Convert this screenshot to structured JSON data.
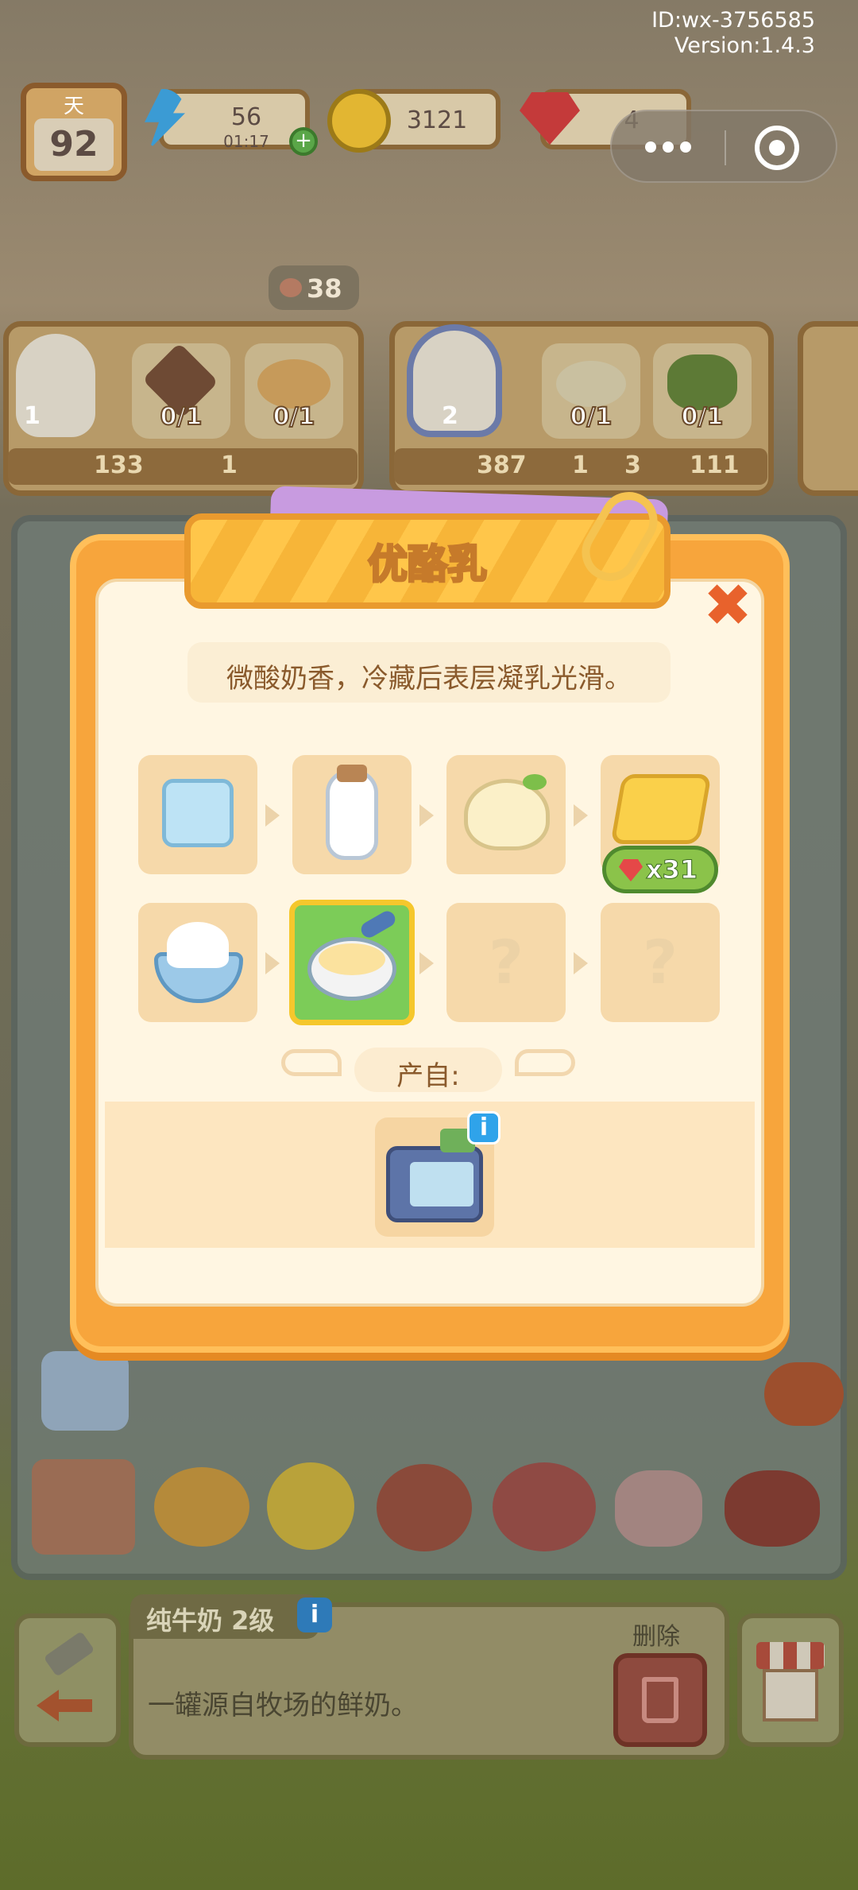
{
  "header": {
    "id_text": "ID:wx-3756585",
    "version_text": "Version:1.4.3",
    "day_label": "天",
    "day_value": "92",
    "energy_value": "56",
    "energy_timer": "01:17",
    "coins_value": "3121",
    "gems_value": "4"
  },
  "orders": {
    "count_badge": "38",
    "cards": [
      {
        "hearts": "1",
        "items": [
          "0/1",
          "0/1"
        ],
        "rewards": [
          "133",
          "1"
        ]
      },
      {
        "hearts": "2",
        "items": [
          "0/1",
          "0/1"
        ],
        "rewards": [
          "387",
          "1",
          "3",
          "111"
        ]
      }
    ]
  },
  "dialog": {
    "title": "优酪乳",
    "description": "微酸奶香，冷藏后表层凝乳光滑。",
    "chain": [
      {
        "name": "ice-cube",
        "icon": "ice-cube-icon"
      },
      {
        "name": "milk-bottle",
        "icon": "milk-bottle-icon"
      },
      {
        "name": "butter-block",
        "icon": "butter-icon"
      },
      {
        "name": "cheese-slices",
        "icon": "cheese-icon",
        "price": "x31"
      },
      {
        "name": "whipped-cream",
        "icon": "cream-bowl-icon"
      },
      {
        "name": "yogurt",
        "icon": "yogurt-icon",
        "selected": true
      },
      {
        "name": "unknown-1",
        "icon": "question-mark-icon",
        "text": "?"
      },
      {
        "name": "unknown-2",
        "icon": "question-mark-icon",
        "text": "?"
      }
    ],
    "produced_from_label": "产自:",
    "source": {
      "name": "yogurt-machine",
      "info": "i"
    }
  },
  "bottom_bar": {
    "item_name": "纯牛奶 2级",
    "info": "i",
    "item_description": "一罐源自牧场的鲜奶。",
    "delete_label": "删除"
  },
  "colors": {
    "dialog_border": "#f5a53a",
    "dialog_body": "#fff6e2",
    "title_text": "#ffffff",
    "description_text": "#8a5a2c",
    "close": "#e8622c",
    "selected_tile": "#7ccc58",
    "price_badge": "#8bc34a"
  }
}
